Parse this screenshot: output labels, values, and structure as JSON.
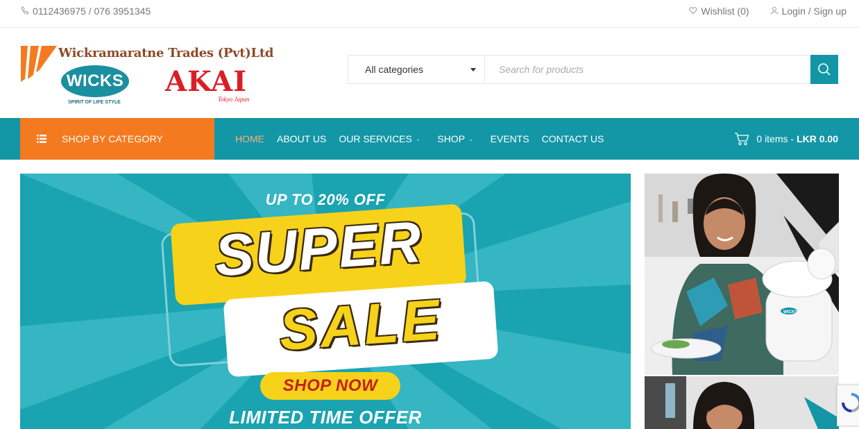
{
  "topbar": {
    "phone": "0112436975 / 076 3951345",
    "wishlist": "Wishlist (0)",
    "login": "Login / Sign up"
  },
  "logo": {
    "company": "Wickramaratne Trades (Pvt)Ltd",
    "wicks": "WICKS",
    "wicks_tagline": "SPIRIT OF LIFE STYLE",
    "akai": "AKAI",
    "akai_tagline": "Tokyo Japan"
  },
  "search": {
    "category": "All categories",
    "placeholder": "Search for products"
  },
  "nav": {
    "shop_by_category": "SHOP BY CATEGORY",
    "items": [
      {
        "label": "HOME"
      },
      {
        "label": "ABOUT US"
      },
      {
        "label": "OUR SERVICES"
      },
      {
        "label": "SHOP"
      },
      {
        "label": "EVENTS"
      },
      {
        "label": "CONTACT US"
      }
    ],
    "cart_items": "0 items -",
    "cart_total": "LKR 0.00"
  },
  "banner": {
    "up_to": "UP TO 20% OFF",
    "super": "SUPER",
    "sale": "SALE",
    "shop_now": "SHOP NOW",
    "limited": "LIMITED TIME OFFER"
  },
  "side_promo": {
    "product_label": "WICKS"
  },
  "colors": {
    "teal": "#1396a6",
    "orange": "#f47a20",
    "active_nav": "#f7b27a",
    "banner_yellow": "#f7d21a"
  },
  "icons": {
    "phone": "phone-icon",
    "wishlist": "heart-icon",
    "login": "user-icon",
    "search": "search-icon",
    "category_list": "list-icon",
    "cart": "cart-icon"
  }
}
